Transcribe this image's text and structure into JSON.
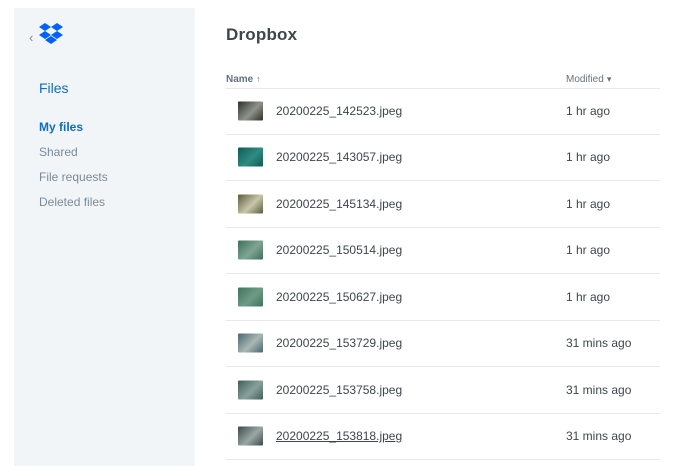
{
  "sidebar": {
    "back_glyph": "‹",
    "logo_icon": "dropbox-logo-icon",
    "title": "Files",
    "items": [
      {
        "label": "My files",
        "active": true
      },
      {
        "label": "Shared",
        "active": false
      },
      {
        "label": "File requests",
        "active": false
      },
      {
        "label": "Deleted files",
        "active": false
      }
    ]
  },
  "main": {
    "title": "Dropbox",
    "columns": {
      "name": "Name",
      "name_sort": "↑",
      "modified": "Modified",
      "modified_sort": "▾"
    },
    "files": [
      {
        "name": "20200225_142523.jpeg",
        "modified": "1 hr ago",
        "thumb": [
          "#2c2f2a",
          "#8e948c"
        ]
      },
      {
        "name": "20200225_143057.jpeg",
        "modified": "1 hr ago",
        "thumb": [
          "#0f5a52",
          "#2f8c82"
        ]
      },
      {
        "name": "20200225_145134.jpeg",
        "modified": "1 hr ago",
        "thumb": [
          "#5b5a3c",
          "#c9c7a9"
        ]
      },
      {
        "name": "20200225_150514.jpeg",
        "modified": "1 hr ago",
        "thumb": [
          "#3d6e5c",
          "#7fa592"
        ]
      },
      {
        "name": "20200225_150627.jpeg",
        "modified": "1 hr ago",
        "thumb": [
          "#3f735e",
          "#6f9b86"
        ]
      },
      {
        "name": "20200225_153729.jpeg",
        "modified": "31 mins ago",
        "thumb": [
          "#4a6570",
          "#a9b8b4"
        ]
      },
      {
        "name": "20200225_153758.jpeg",
        "modified": "31 mins ago",
        "thumb": [
          "#3f5f58",
          "#8aa09b"
        ]
      },
      {
        "name": "20200225_153818.jpeg",
        "modified": "31 mins ago",
        "thumb": [
          "#394a4d",
          "#9aa7a4"
        ]
      }
    ]
  },
  "colors": {
    "accent": "#0f6cbd",
    "sidebar_bg": "#f2f5f8",
    "text": "#3d464d",
    "muted": "#7a8a99"
  }
}
